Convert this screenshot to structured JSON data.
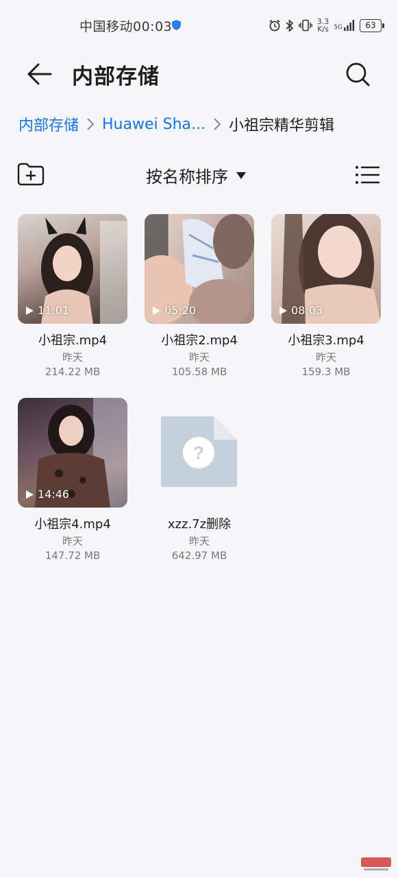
{
  "status_bar": {
    "carrier_time": "中国移动00:03",
    "net_speed_value": "3.3",
    "net_speed_unit": "K/s",
    "signal_label": "5G",
    "battery": "63"
  },
  "app_bar": {
    "title": "内部存储"
  },
  "breadcrumb": {
    "items": [
      "内部存储",
      "Huawei Sha...",
      "小祖宗精华剪辑"
    ]
  },
  "toolbar": {
    "sort_label": "按名称排序"
  },
  "files": [
    {
      "name": "小祖宗.mp4",
      "date": "昨天",
      "size": "214.22 MB",
      "duration": "11:01"
    },
    {
      "name": "小祖宗2.mp4",
      "date": "昨天",
      "size": "105.58 MB",
      "duration": "05:20"
    },
    {
      "name": "小祖宗3.mp4",
      "date": "昨天",
      "size": "159.3 MB",
      "duration": "08:03"
    },
    {
      "name": "小祖宗4.mp4",
      "date": "昨天",
      "size": "147.72 MB",
      "duration": "14:46"
    },
    {
      "name": "xzz.7z删除",
      "date": "昨天",
      "size": "642.97 MB",
      "icon": "unknown-file-icon"
    }
  ],
  "colors": {
    "accent": "#1473e6",
    "background": "#f6f6f8",
    "unknown_file": "#c4d1dd"
  }
}
